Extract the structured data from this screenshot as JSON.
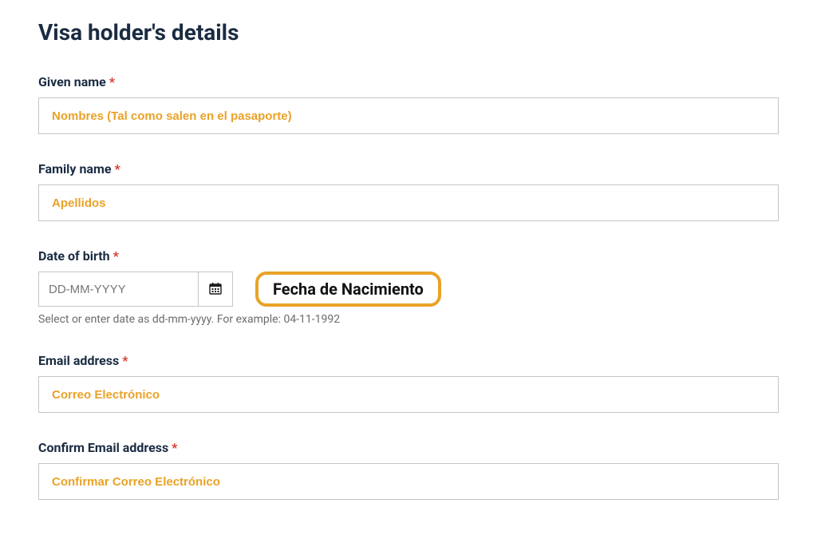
{
  "section_title": "Visa holder's details",
  "required_marker": "*",
  "fields": {
    "given_name": {
      "label": "Given name",
      "placeholder": "Nombres (Tal como salen en el pasaporte)",
      "value": ""
    },
    "family_name": {
      "label": "Family name",
      "placeholder": "Apellidos",
      "value": ""
    },
    "dob": {
      "label": "Date of birth",
      "placeholder": "DD-MM-YYYY",
      "value": "",
      "helper": "Select or enter date as dd-mm-yyyy. For example: 04-11-1992",
      "annotation": "Fecha de Nacimiento"
    },
    "email": {
      "label": "Email address",
      "placeholder": "Correo Electrónico",
      "value": ""
    },
    "confirm_email": {
      "label": "Confirm Email address",
      "placeholder": "Confirmar Correo Electrónico",
      "value": ""
    }
  }
}
